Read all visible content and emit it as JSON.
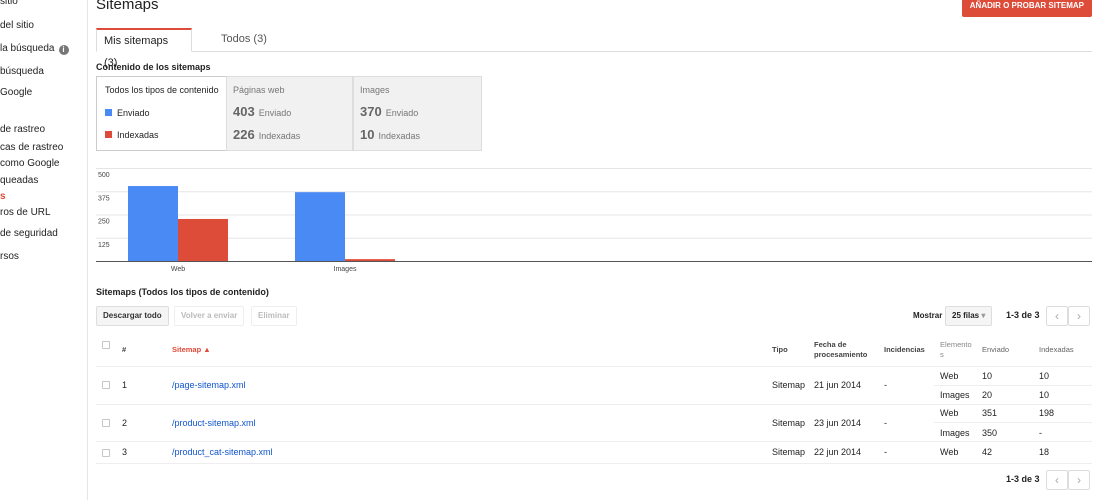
{
  "sidebar": {
    "items": [
      {
        "label": "sitio"
      },
      {
        "label": "del sitio"
      },
      {
        "label": "la búsqueda"
      },
      {
        "label": "búsqueda"
      },
      {
        "label": "Google"
      },
      {
        "label": "de rastreo"
      },
      {
        "label": "cas de rastreo"
      },
      {
        "label": "como Google"
      },
      {
        "label": "queadas"
      },
      {
        "label": "s"
      },
      {
        "label": "ros de URL"
      },
      {
        "label": "de seguridad"
      },
      {
        "label": "rsos"
      }
    ],
    "info_icon_glyph": "i"
  },
  "header": {
    "title": "Sitemaps",
    "add_button": "AÑADIR O PROBAR SITEMAP",
    "accent_color": "#dd4b39"
  },
  "tabs": [
    {
      "label": "Mis sitemaps (3)",
      "active": true
    },
    {
      "label": "Todos (3)",
      "active": false
    }
  ],
  "summary": {
    "heading": "Contenido de los sitemaps",
    "all_types": {
      "title": "Todos los tipos de contenido",
      "submitted_label": "Enviado",
      "indexed_label": "Indexadas",
      "submitted_color": "#4a8af4",
      "indexed_color": "#dd4b39"
    },
    "web": {
      "title": "Páginas web",
      "submitted": "403",
      "submitted_label": "Enviado",
      "indexed": "226",
      "indexed_label": "Indexadas"
    },
    "images": {
      "title": "Images",
      "submitted": "370",
      "submitted_label": "Enviado",
      "indexed": "10",
      "indexed_label": "Indexadas"
    }
  },
  "chart_data": {
    "type": "bar",
    "categories": [
      "Web",
      "Images"
    ],
    "series": [
      {
        "values": [
          403,
          370
        ],
        "color": "#4a8af4"
      },
      {
        "values": [
          226,
          10
        ],
        "color": "#dd4b39"
      }
    ],
    "y_ticks": [
      "500",
      "375",
      "250",
      "125"
    ],
    "ylim": [
      0,
      500
    ],
    "grid": true
  },
  "table_section": {
    "heading": "Sitemaps (Todos los tipos de contenido)",
    "download_button": "Descargar todo",
    "resubmit_button": "Volver a enviar",
    "delete_button": "Eliminar",
    "show_label": "Mostrar",
    "rows_select": "25 filas",
    "range_text": "1-3 de 3",
    "prev_glyph": "‹",
    "next_glyph": "›"
  },
  "table": {
    "headers": {
      "num": "#",
      "sitemap": "Sitemap ▲",
      "type": "Tipo",
      "date_line1": "Fecha de",
      "date_line2": "procesamiento",
      "issues": "Incidencias",
      "elements_line1": "Elemento",
      "elements_line2": "s",
      "submitted": "Enviado",
      "indexed": "Indexadas"
    },
    "rows": [
      {
        "num": "1",
        "sitemap": "/page-sitemap.xml",
        "type": "Sitemap",
        "date": "21 jun 2014",
        "issues": "-",
        "items": [
          {
            "element": "Web",
            "submitted": "10",
            "indexed": "10"
          },
          {
            "element": "Images",
            "submitted": "20",
            "indexed": "10"
          }
        ]
      },
      {
        "num": "2",
        "sitemap": "/product-sitemap.xml",
        "type": "Sitemap",
        "date": "23 jun 2014",
        "issues": "-",
        "items": [
          {
            "element": "Web",
            "submitted": "351",
            "indexed": "198"
          },
          {
            "element": "Images",
            "submitted": "350",
            "indexed": "-"
          }
        ]
      },
      {
        "num": "3",
        "sitemap": "/product_cat-sitemap.xml",
        "type": "Sitemap",
        "date": "22 jun 2014",
        "issues": "-",
        "items": [
          {
            "element": "Web",
            "submitted": "42",
            "indexed": "18"
          }
        ]
      }
    ]
  }
}
